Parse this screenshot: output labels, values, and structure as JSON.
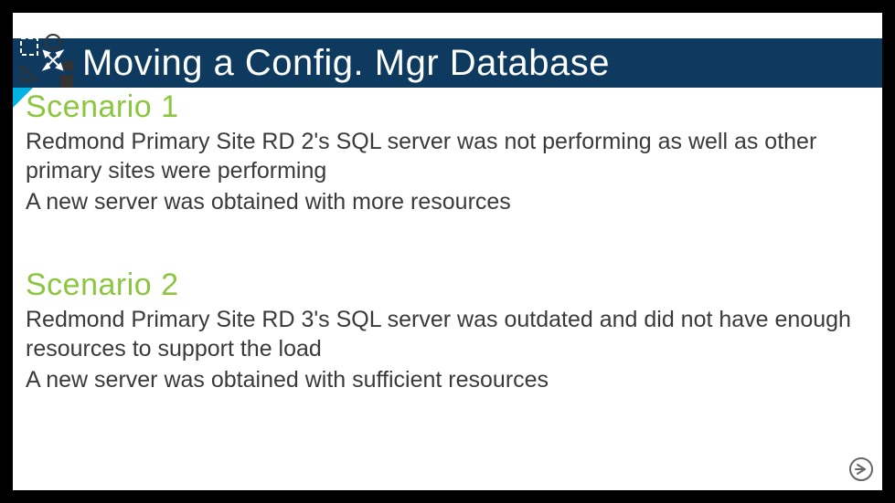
{
  "title": "Moving a Config. Mgr Database",
  "scenario1": {
    "heading": "Scenario 1",
    "line1": "Redmond Primary Site RD 2's SQL server was not performing as well as other primary sites were performing",
    "line2": "A new server was obtained with more resources"
  },
  "scenario2": {
    "heading": "Scenario 2",
    "line1": "Redmond Primary Site RD 3's SQL server was outdated and did not have enough resources to support the load",
    "line2": "A new server was obtained with sufficient resources"
  },
  "icons": {
    "logo": "shapes-logo",
    "nav": "arrow-right-circle"
  },
  "colors": {
    "titlebar": "#0f3a5f",
    "accent": "#00b3e3",
    "heading": "#8cc63f",
    "body": "#3a3a3a"
  }
}
